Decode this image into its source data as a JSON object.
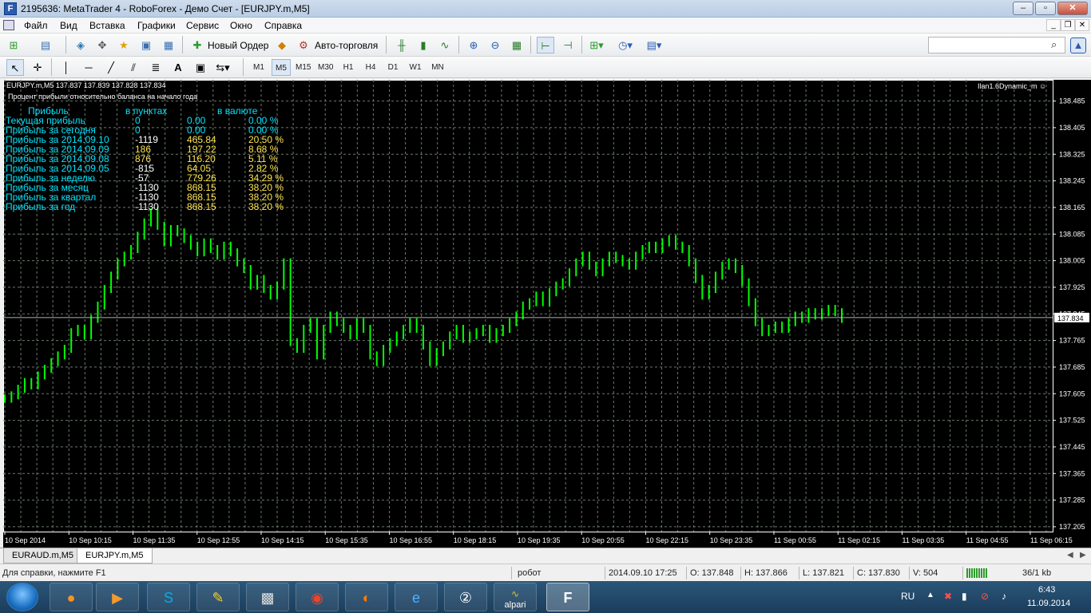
{
  "window": {
    "title": "2195636: MetaTrader 4 - RoboForex - Демо Счет - [EURJPY.m,M5]",
    "minimize": "–",
    "maximize": "▫",
    "close": "✕"
  },
  "menu": [
    "Файл",
    "Вид",
    "Вставка",
    "Графики",
    "Сервис",
    "Окно",
    "Справка"
  ],
  "toolbar": {
    "new_order": "Новый Ордер",
    "auto_trading": "Авто-торговля"
  },
  "timeframes": [
    "M1",
    "M5",
    "M15",
    "M30",
    "H1",
    "H4",
    "D1",
    "W1",
    "MN"
  ],
  "active_timeframe": "M5",
  "chart": {
    "header": "EURJPY.m,M5  137.837 137.839 137.828 137.834",
    "subtitle": "Процент прибыли относительно баланса на начало года",
    "ea_name": "Ilan1.6Dynamic_m",
    "current_price": "137.834",
    "stats_header": {
      "label": "Прибыль",
      "points": "в пунктах",
      "currency": "в валюте"
    },
    "stats": [
      {
        "label": "Текущая прибыль",
        "points": "0",
        "currency": "0.00",
        "percent": "0.00 %",
        "color": "cyan"
      },
      {
        "label": "Прибыль за сегодня",
        "points": "0",
        "currency": "0.00",
        "percent": "0.00 %",
        "color": "cyan"
      },
      {
        "label": "Прибыль за 2014.09.10",
        "points": "-1119",
        "currency": "465.84",
        "percent": "20.50 %",
        "color": "white"
      },
      {
        "label": "Прибыль за 2014.09.09",
        "points": "186",
        "currency": "197.22",
        "percent": "8.68 %",
        "color": "yellow"
      },
      {
        "label": "Прибыль за 2014.09.08",
        "points": "876",
        "currency": "116.20",
        "percent": "5.11 %",
        "color": "yellow"
      },
      {
        "label": "Прибыль за 2014.09.05",
        "points": "-815",
        "currency": "64.05",
        "percent": "2.82 %",
        "color": "white"
      },
      {
        "label": "Прибыль за неделю",
        "points": "-57",
        "currency": "779.26",
        "percent": "34.29 %",
        "color": "white"
      },
      {
        "label": "Прибыль за месяц",
        "points": "-1130",
        "currency": "868.15",
        "percent": "38.20 %",
        "color": "white"
      },
      {
        "label": "Прибыль за квартал",
        "points": "-1130",
        "currency": "868.15",
        "percent": "38.20 %",
        "color": "white"
      },
      {
        "label": "Прибыль за год",
        "points": "-1130",
        "currency": "868.15",
        "percent": "38.20 %",
        "color": "white"
      }
    ]
  },
  "chart_data": {
    "type": "line",
    "title": "EURJPY.m,M5",
    "price_ticks": [
      "138.485",
      "138.405",
      "138.325",
      "138.245",
      "138.165",
      "138.085",
      "138.005",
      "137.925",
      "137.845",
      "137.765",
      "137.685",
      "137.605",
      "137.525",
      "137.445",
      "137.365",
      "137.285",
      "137.205"
    ],
    "time_ticks": [
      "10 Sep 2014",
      "10 Sep 10:15",
      "10 Sep 11:35",
      "10 Sep 12:55",
      "10 Sep 14:15",
      "10 Sep 15:35",
      "10 Sep 16:55",
      "10 Sep 18:15",
      "10 Sep 19:35",
      "10 Sep 20:55",
      "10 Sep 22:15",
      "10 Sep 23:35",
      "11 Sep 00:55",
      "11 Sep 02:15",
      "11 Sep 03:35",
      "11 Sep 04:55",
      "11 Sep 06:15"
    ],
    "ylim": [
      137.2,
      138.52
    ],
    "series": [
      {
        "values": [
          137.59,
          137.6,
          137.62,
          137.64,
          137.63,
          137.66,
          137.68,
          137.7,
          137.72,
          137.74,
          137.79,
          137.8,
          137.78,
          137.83,
          137.87,
          137.92,
          137.96,
          138.0,
          138.02,
          138.04,
          138.08,
          138.12,
          138.15,
          138.11,
          138.06,
          138.1,
          138.09,
          138.07,
          138.05,
          138.03,
          138.06,
          138.04,
          138.02,
          138.05,
          138.03,
          138.0,
          137.98,
          137.93,
          137.95,
          137.92,
          137.9,
          137.93,
          138.0,
          137.76,
          137.74,
          137.8,
          137.82,
          137.72,
          137.8,
          137.84,
          137.82,
          137.8,
          137.78,
          137.82,
          137.8,
          137.72,
          137.7,
          137.74,
          137.76,
          137.78,
          137.8,
          137.82,
          137.8,
          137.75,
          137.7,
          137.73,
          137.75,
          137.78,
          137.8,
          137.77,
          137.78,
          137.79,
          137.8,
          137.77,
          137.79,
          137.8,
          137.82,
          137.84,
          137.87,
          137.88,
          137.9,
          137.88,
          137.91,
          137.93,
          137.94,
          137.97,
          138.0,
          138.02,
          137.99,
          137.97,
          138.0,
          138.02,
          138.01,
          138.0,
          137.99,
          138.02,
          138.04,
          138.05,
          138.04,
          138.06,
          138.07,
          138.05,
          138.04,
          138.0,
          137.95,
          137.9,
          137.92,
          137.96,
          137.99,
          138.0,
          137.98,
          137.94,
          137.88,
          137.82,
          137.79,
          137.8,
          137.81,
          137.8,
          137.82,
          137.84,
          137.83,
          137.85,
          137.84,
          137.85,
          137.86,
          137.85,
          137.83
        ]
      }
    ],
    "grid": true,
    "price_line": 137.834
  },
  "tabs": [
    "EURAUD.m,M5",
    "EURJPY.m,M5"
  ],
  "active_tab": "EURJPY.m,M5",
  "status": {
    "help": "Для справки, нажмите F1",
    "profile": "робот",
    "datetime": "2014.09.10 17:25",
    "open": "O: 137.848",
    "high": "H: 137.866",
    "low": "L: 137.821",
    "close": "C: 137.830",
    "volume": "V: 504",
    "traffic": "36/1 kb"
  },
  "taskbar": {
    "apps": [
      "odnoklassniki",
      "media-player",
      "skype",
      "pen-editor",
      "movie-maker",
      "chrome",
      "firefox",
      "internet-explorer",
      "badge-app",
      "alpari",
      "metatrader"
    ],
    "alpari_label": "alpari",
    "lang": "RU",
    "time": "6:43",
    "date": "11.09.2014"
  }
}
